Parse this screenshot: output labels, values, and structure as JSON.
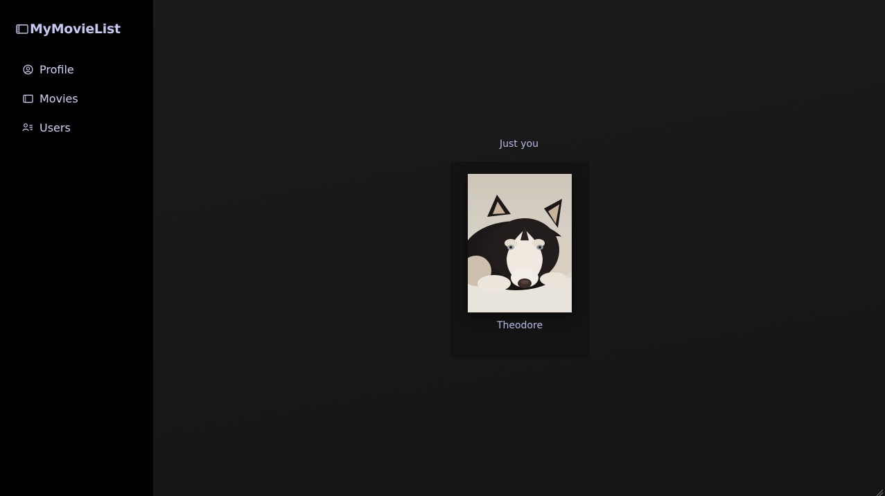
{
  "app": {
    "title": "MyMovieList",
    "brand_icon": "film-icon",
    "accent_color": "#c6c8f2"
  },
  "sidebar": {
    "items": [
      {
        "label": "Profile",
        "icon": "user-circle-icon"
      },
      {
        "label": "Movies",
        "icon": "film-icon"
      },
      {
        "label": "Users",
        "icon": "users-list-icon"
      }
    ]
  },
  "main": {
    "caption": "Just you",
    "users": [
      {
        "name": "Theodore",
        "avatar": "husky-puppy-photo"
      }
    ]
  }
}
